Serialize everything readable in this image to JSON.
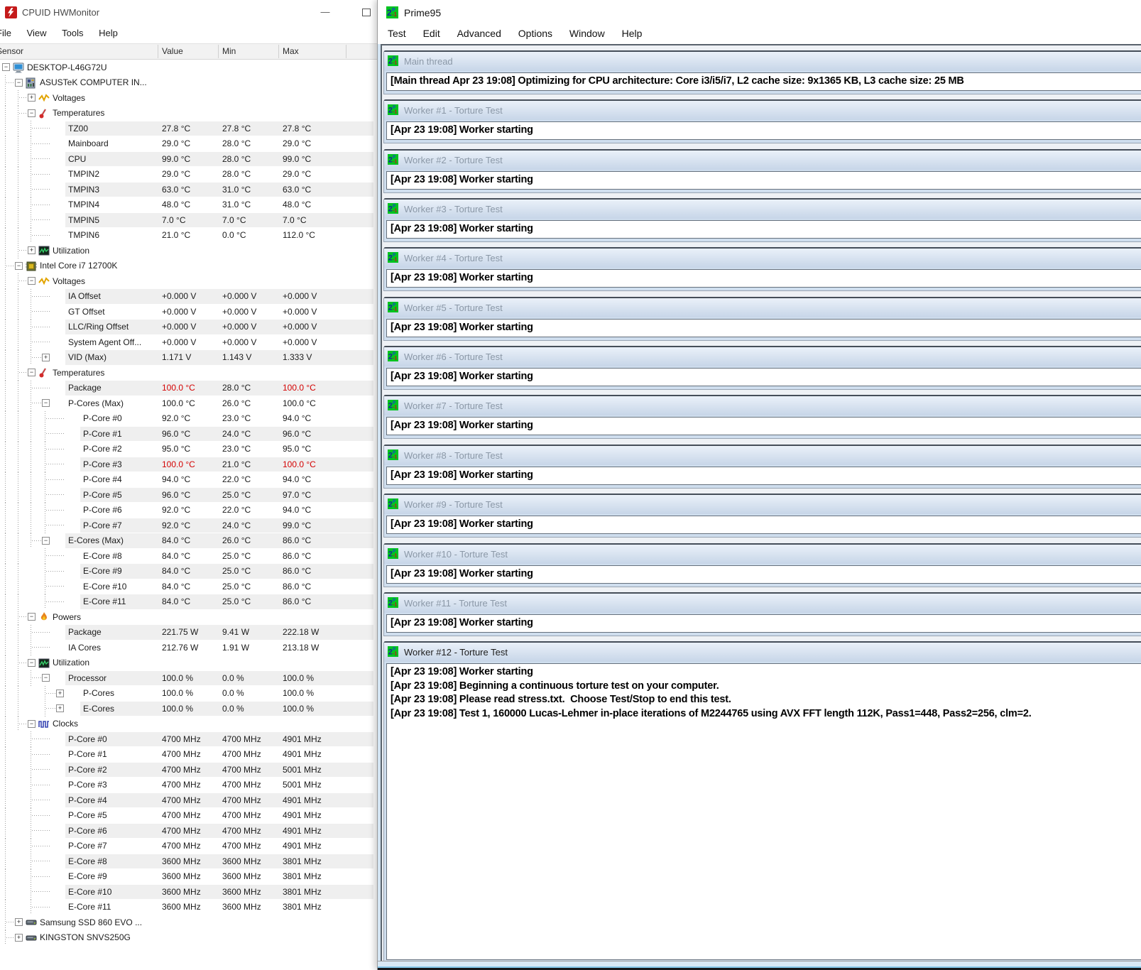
{
  "colors": {
    "alarm_red": "#d40000",
    "row_stripe": "#efefef",
    "prime95_icon_green": "#00c41f",
    "child_title_gradient_top": "#eaf1f9",
    "child_title_gradient_bottom": "#c7d6e8",
    "hwmonitor_icon_red": "#c41a1a"
  },
  "hwmonitor": {
    "title": "CPUID HWMonitor",
    "menu": [
      "File",
      "View",
      "Tools",
      "Help"
    ],
    "window_controls": {
      "minimize": "—",
      "maximize": "□"
    },
    "columns": [
      "Sensor",
      "Value",
      "Min",
      "Max"
    ],
    "rows": [
      {
        "depth": 0,
        "label": "DESKTOP-L46G72U",
        "icon": "computer",
        "expander": "minus"
      },
      {
        "depth": 1,
        "label": "ASUSTeK COMPUTER IN...",
        "icon": "motherboard",
        "expander": "minus"
      },
      {
        "depth": 2,
        "label": "Voltages",
        "icon": "voltage",
        "expander": "plus"
      },
      {
        "depth": 2,
        "label": "Temperatures",
        "icon": "temperature",
        "expander": "minus"
      },
      {
        "depth": 3,
        "label": "TZ00",
        "value": "27.8 °C",
        "min": "27.8 °C",
        "max": "27.8 °C",
        "striped": true
      },
      {
        "depth": 3,
        "label": "Mainboard",
        "value": "29.0 °C",
        "min": "28.0 °C",
        "max": "29.0 °C"
      },
      {
        "depth": 3,
        "label": "CPU",
        "value": "99.0 °C",
        "min": "28.0 °C",
        "max": "99.0 °C",
        "striped": true
      },
      {
        "depth": 3,
        "label": "TMPIN2",
        "value": "29.0 °C",
        "min": "28.0 °C",
        "max": "29.0 °C"
      },
      {
        "depth": 3,
        "label": "TMPIN3",
        "value": "63.0 °C",
        "min": "31.0 °C",
        "max": "63.0 °C",
        "striped": true
      },
      {
        "depth": 3,
        "label": "TMPIN4",
        "value": "48.0 °C",
        "min": "31.0 °C",
        "max": "48.0 °C"
      },
      {
        "depth": 3,
        "label": "TMPIN5",
        "value": "7.0 °C",
        "min": "7.0 °C",
        "max": "7.0 °C",
        "striped": true
      },
      {
        "depth": 3,
        "label": "TMPIN6",
        "value": "21.0 °C",
        "min": "0.0 °C",
        "max": "112.0 °C"
      },
      {
        "depth": 2,
        "label": "Utilization",
        "icon": "utilization",
        "expander": "plus"
      },
      {
        "depth": 1,
        "label": "Intel Core i7 12700K",
        "icon": "cpu",
        "expander": "minus"
      },
      {
        "depth": 2,
        "label": "Voltages",
        "icon": "voltage",
        "expander": "minus"
      },
      {
        "depth": 3,
        "label": "IA Offset",
        "value": "+0.000 V",
        "min": "+0.000 V",
        "max": "+0.000 V",
        "striped": true
      },
      {
        "depth": 3,
        "label": "GT Offset",
        "value": "+0.000 V",
        "min": "+0.000 V",
        "max": "+0.000 V"
      },
      {
        "depth": 3,
        "label": "LLC/Ring Offset",
        "value": "+0.000 V",
        "min": "+0.000 V",
        "max": "+0.000 V",
        "striped": true
      },
      {
        "depth": 3,
        "label": "System Agent Off...",
        "value": "+0.000 V",
        "min": "+0.000 V",
        "max": "+0.000 V"
      },
      {
        "depth": 3,
        "label": "VID (Max)",
        "expander": "plus",
        "value": "1.171 V",
        "min": "1.143 V",
        "max": "1.333 V",
        "striped": true
      },
      {
        "depth": 2,
        "label": "Temperatures",
        "icon": "temperature",
        "expander": "minus"
      },
      {
        "depth": 3,
        "label": "Package",
        "value": "100.0 °C",
        "min": "28.0 °C",
        "max": "100.0 °C",
        "striped": true,
        "red": true
      },
      {
        "depth": 3,
        "label": "P-Cores (Max)",
        "expander": "minus",
        "value": "100.0 °C",
        "min": "26.0 °C",
        "max": "100.0 °C"
      },
      {
        "depth": 4,
        "label": "P-Core #0",
        "value": "92.0 °C",
        "min": "23.0 °C",
        "max": "94.0 °C"
      },
      {
        "depth": 4,
        "label": "P-Core #1",
        "value": "96.0 °C",
        "min": "24.0 °C",
        "max": "96.0 °C",
        "striped": true
      },
      {
        "depth": 4,
        "label": "P-Core #2",
        "value": "95.0 °C",
        "min": "23.0 °C",
        "max": "95.0 °C"
      },
      {
        "depth": 4,
        "label": "P-Core #3",
        "value": "100.0 °C",
        "min": "21.0 °C",
        "max": "100.0 °C",
        "striped": true,
        "red": true
      },
      {
        "depth": 4,
        "label": "P-Core #4",
        "value": "94.0 °C",
        "min": "22.0 °C",
        "max": "94.0 °C"
      },
      {
        "depth": 4,
        "label": "P-Core #5",
        "value": "96.0 °C",
        "min": "25.0 °C",
        "max": "97.0 °C",
        "striped": true
      },
      {
        "depth": 4,
        "label": "P-Core #6",
        "value": "92.0 °C",
        "min": "22.0 °C",
        "max": "94.0 °C"
      },
      {
        "depth": 4,
        "label": "P-Core #7",
        "value": "92.0 °C",
        "min": "24.0 °C",
        "max": "99.0 °C",
        "striped": true
      },
      {
        "depth": 3,
        "label": "E-Cores (Max)",
        "expander": "minus",
        "value": "84.0 °C",
        "min": "26.0 °C",
        "max": "86.0 °C",
        "striped": true
      },
      {
        "depth": 4,
        "label": "E-Core #8",
        "value": "84.0 °C",
        "min": "25.0 °C",
        "max": "86.0 °C"
      },
      {
        "depth": 4,
        "label": "E-Core #9",
        "value": "84.0 °C",
        "min": "25.0 °C",
        "max": "86.0 °C",
        "striped": true
      },
      {
        "depth": 4,
        "label": "E-Core #10",
        "value": "84.0 °C",
        "min": "25.0 °C",
        "max": "86.0 °C"
      },
      {
        "depth": 4,
        "label": "E-Core #11",
        "value": "84.0 °C",
        "min": "25.0 °C",
        "max": "86.0 °C",
        "striped": true
      },
      {
        "depth": 2,
        "label": "Powers",
        "icon": "power",
        "expander": "minus"
      },
      {
        "depth": 3,
        "label": "Package",
        "value": "221.75 W",
        "min": "9.41 W",
        "max": "222.18 W",
        "striped": true
      },
      {
        "depth": 3,
        "label": "IA Cores",
        "value": "212.76 W",
        "min": "1.91 W",
        "max": "213.18 W"
      },
      {
        "depth": 2,
        "label": "Utilization",
        "icon": "utilization",
        "expander": "minus"
      },
      {
        "depth": 3,
        "label": "Processor",
        "expander": "minus",
        "value": "100.0 %",
        "min": "0.0 %",
        "max": "100.0 %",
        "striped": true
      },
      {
        "depth": 4,
        "label": "P-Cores",
        "expander": "plus",
        "value": "100.0 %",
        "min": "0.0 %",
        "max": "100.0 %"
      },
      {
        "depth": 4,
        "label": "E-Cores",
        "expander": "plus",
        "value": "100.0 %",
        "min": "0.0 %",
        "max": "100.0 %",
        "striped": true
      },
      {
        "depth": 2,
        "label": "Clocks",
        "icon": "clock",
        "expander": "minus"
      },
      {
        "depth": 3,
        "label": "P-Core #0",
        "value": "4700 MHz",
        "min": "4700 MHz",
        "max": "4901 MHz",
        "striped": true
      },
      {
        "depth": 3,
        "label": "P-Core #1",
        "value": "4700 MHz",
        "min": "4700 MHz",
        "max": "4901 MHz"
      },
      {
        "depth": 3,
        "label": "P-Core #2",
        "value": "4700 MHz",
        "min": "4700 MHz",
        "max": "5001 MHz",
        "striped": true
      },
      {
        "depth": 3,
        "label": "P-Core #3",
        "value": "4700 MHz",
        "min": "4700 MHz",
        "max": "5001 MHz"
      },
      {
        "depth": 3,
        "label": "P-Core #4",
        "value": "4700 MHz",
        "min": "4700 MHz",
        "max": "4901 MHz",
        "striped": true
      },
      {
        "depth": 3,
        "label": "P-Core #5",
        "value": "4700 MHz",
        "min": "4700 MHz",
        "max": "4901 MHz"
      },
      {
        "depth": 3,
        "label": "P-Core #6",
        "value": "4700 MHz",
        "min": "4700 MHz",
        "max": "4901 MHz",
        "striped": true
      },
      {
        "depth": 3,
        "label": "P-Core #7",
        "value": "4700 MHz",
        "min": "4700 MHz",
        "max": "4901 MHz"
      },
      {
        "depth": 3,
        "label": "E-Core #8",
        "value": "3600 MHz",
        "min": "3600 MHz",
        "max": "3801 MHz",
        "striped": true
      },
      {
        "depth": 3,
        "label": "E-Core #9",
        "value": "3600 MHz",
        "min": "3600 MHz",
        "max": "3801 MHz"
      },
      {
        "depth": 3,
        "label": "E-Core #10",
        "value": "3600 MHz",
        "min": "3600 MHz",
        "max": "3801 MHz",
        "striped": true
      },
      {
        "depth": 3,
        "label": "E-Core #11",
        "value": "3600 MHz",
        "min": "3600 MHz",
        "max": "3801 MHz"
      },
      {
        "depth": 1,
        "label": "Samsung SSD 860 EVO ...",
        "icon": "disk",
        "expander": "plus"
      },
      {
        "depth": 1,
        "label": "KINGSTON SNVS250G",
        "icon": "disk",
        "expander": "plus"
      }
    ]
  },
  "prime95": {
    "title": "Prime95",
    "menu": [
      "Test",
      "Edit",
      "Advanced",
      "Options",
      "Window",
      "Help"
    ],
    "windows": [
      {
        "title": "Main thread",
        "active": false,
        "lines": [
          "[Main thread Apr 23 19:08] Optimizing for CPU architecture: Core i3/i5/i7, L2 cache size: 9x1365 KB, L3 cache size: 25 MB"
        ]
      },
      {
        "title": "Worker #1 - Torture Test",
        "active": false,
        "lines": [
          "[Apr 23 19:08] Worker starting"
        ]
      },
      {
        "title": "Worker #2 - Torture Test",
        "active": false,
        "lines": [
          "[Apr 23 19:08] Worker starting"
        ]
      },
      {
        "title": "Worker #3 - Torture Test",
        "active": false,
        "lines": [
          "[Apr 23 19:08] Worker starting"
        ]
      },
      {
        "title": "Worker #4 - Torture Test",
        "active": false,
        "lines": [
          "[Apr 23 19:08] Worker starting"
        ]
      },
      {
        "title": "Worker #5 - Torture Test",
        "active": false,
        "lines": [
          "[Apr 23 19:08] Worker starting"
        ]
      },
      {
        "title": "Worker #6 - Torture Test",
        "active": false,
        "lines": [
          "[Apr 23 19:08] Worker starting"
        ]
      },
      {
        "title": "Worker #7 - Torture Test",
        "active": false,
        "lines": [
          "[Apr 23 19:08] Worker starting"
        ]
      },
      {
        "title": "Worker #8 - Torture Test",
        "active": false,
        "lines": [
          "[Apr 23 19:08] Worker starting"
        ]
      },
      {
        "title": "Worker #9 - Torture Test",
        "active": false,
        "lines": [
          "[Apr 23 19:08] Worker starting"
        ]
      },
      {
        "title": "Worker #10 - Torture Test",
        "active": false,
        "lines": [
          "[Apr 23 19:08] Worker starting"
        ]
      },
      {
        "title": "Worker #11 - Torture Test",
        "active": false,
        "lines": [
          "[Apr 23 19:08] Worker starting"
        ]
      },
      {
        "title": "Worker #12 - Torture Test",
        "active": true,
        "lines": [
          "[Apr 23 19:08] Worker starting",
          "[Apr 23 19:08] Beginning a continuous torture test on your computer.",
          "[Apr 23 19:08] Please read stress.txt.  Choose Test/Stop to end this test.",
          "[Apr 23 19:08] Test 1, 160000 Lucas-Lehmer in-place iterations of M2244765 using AVX FFT length 112K, Pass1=448, Pass2=256, clm=2."
        ]
      }
    ]
  }
}
